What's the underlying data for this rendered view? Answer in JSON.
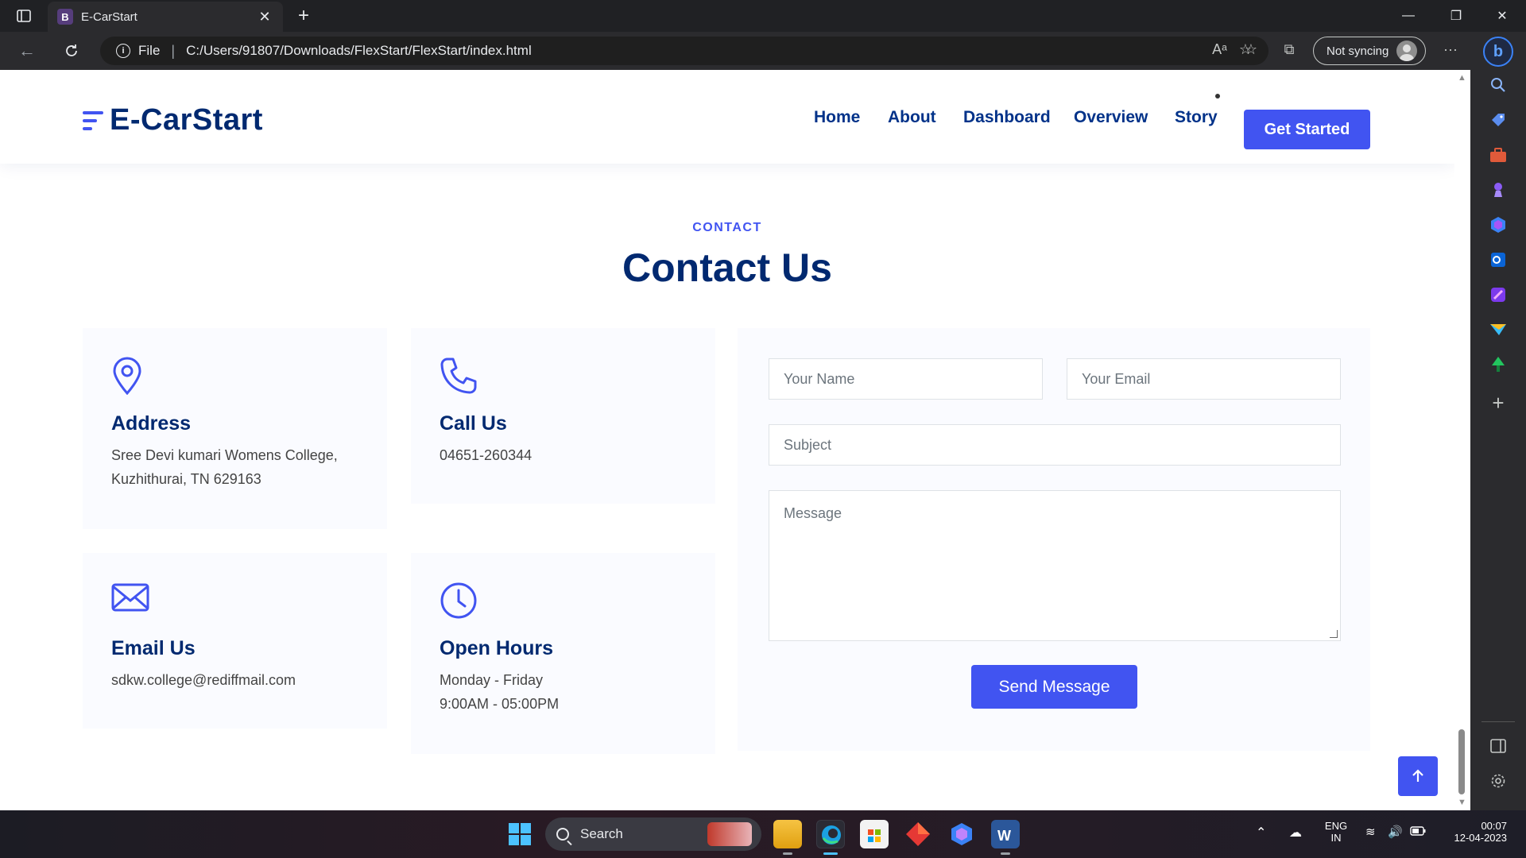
{
  "browser": {
    "tab_title": "E-CarStart",
    "tab_favicon_letter": "B",
    "address": {
      "scheme_label": "File",
      "url": "C:/Users/91807/Downloads/FlexStart/FlexStart/index.html"
    },
    "sync_label": "Not syncing"
  },
  "site": {
    "brand": "E-CarStart",
    "nav": [
      {
        "label": "Home"
      },
      {
        "label": "About"
      },
      {
        "label": "Dashboard"
      },
      {
        "label": "Overview"
      },
      {
        "label": "Story"
      }
    ],
    "cta_label": "Get Started"
  },
  "contact": {
    "kicker": "CONTACT",
    "title": "Contact Us",
    "cards": [
      {
        "icon": "map-pin-icon",
        "title": "Address",
        "lines": [
          "Sree Devi kumari Womens College,",
          "Kuzhithurai, TN 629163"
        ]
      },
      {
        "icon": "phone-icon",
        "title": "Call Us",
        "lines": [
          "04651-260344"
        ]
      },
      {
        "icon": "envelope-icon",
        "title": "Email Us",
        "lines": [
          "sdkw.college@rediffmail.com"
        ]
      },
      {
        "icon": "clock-icon",
        "title": "Open Hours",
        "lines": [
          "Monday - Friday",
          "9:00AM - 05:00PM"
        ]
      }
    ],
    "form": {
      "name_placeholder": "Your Name",
      "email_placeholder": "Your Email",
      "subject_placeholder": "Subject",
      "message_placeholder": "Message",
      "submit_label": "Send Message"
    }
  },
  "taskbar": {
    "search_label": "Search",
    "language": "ENG",
    "region": "IN",
    "time": "00:07",
    "date": "12-04-2023"
  },
  "colors": {
    "accent": "#4154f1",
    "heading": "#012970",
    "card_bg": "#fafbff"
  }
}
